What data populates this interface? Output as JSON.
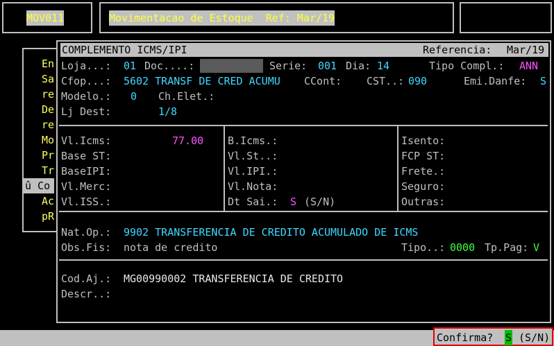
{
  "header": {
    "program_code": "MOV011",
    "title": "Movimentacao de Estoque  Ref: Mar/19"
  },
  "side_menu": {
    "items": [
      "En",
      "Sa",
      "re",
      "De",
      "re",
      "Mo",
      "Pr",
      "Tr",
      "û Co",
      "Ac",
      "pR"
    ],
    "selected_index": 8
  },
  "dialog": {
    "title": "COMPLEMENTO ICMS/IPI",
    "referencia_label": "Referencia:",
    "referencia_value": "Mar/19",
    "row1": {
      "loja_label": "Loja...:",
      "loja_value": "01",
      "doc_label": "Doc....:",
      "doc_value": "",
      "serie_label": "Serie:",
      "serie_value": "001",
      "dia_label": "Dia:",
      "dia_value": "14",
      "tipo_compl_label": "Tipo Compl.:",
      "tipo_compl_value": "ANN"
    },
    "row2": {
      "cfop_label": "Cfop...:",
      "cfop_value": "5602 TRANSF DE CRED ACUMU",
      "ccont_label": "CCont:",
      "cst_label": "CST..:",
      "cst_value": "090",
      "emi_danfe_label": "Emi.Danfe:",
      "emi_danfe_value": "S"
    },
    "row3": {
      "modelo_label": "Modelo.:",
      "modelo_value": "0",
      "ch_elet_label": "Ch.Elet.:"
    },
    "row4": {
      "lj_dest_label": "Lj Dest:",
      "lj_dest_value": "1/8"
    },
    "values_col1": {
      "vl_icms_label": "Vl.Icms:",
      "vl_icms_value": "77.00",
      "base_st_label": "Base ST:",
      "base_ipi_label": "BaseIPI:",
      "vl_merc_label": "Vl.Merc:",
      "vl_iss_label": "Vl.ISS.:"
    },
    "values_col2": {
      "b_icms_label": "B.Icms.:",
      "vl_st_label": "Vl.St..:",
      "vl_ipi_label": "Vl.IPI.:",
      "vl_nota_label": "Vl.Nota:",
      "dt_sai_label": "Dt Sai.:",
      "dt_sai_value": "S",
      "dt_sai_hint": "(S/N)"
    },
    "values_col3": {
      "isento_label": "Isento:",
      "fcp_st_label": "FCP ST:",
      "frete_label": "Frete.:",
      "seguro_label": "Seguro:",
      "outras_label": "Outras:"
    },
    "nat_op_label": "Nat.Op.:",
    "nat_op_value": "9902 TRANSFERENCIA DE CREDITO ACUMULADO DE ICMS",
    "obs_fis_label": "Obs.Fis:",
    "obs_fis_value": "nota de credito",
    "tipo_label": "Tipo..:",
    "tipo_value": "0000",
    "tp_pag_label": "Tp.Pag:",
    "tp_pag_value": "V",
    "cod_aj_label": "Cod.Aj.:",
    "cod_aj_value": "MG00990002 TRANSFERENCIA DE CREDITO",
    "descr_label": "Descr..:"
  },
  "status_bar": {
    "confirm_label": "Confirma?",
    "confirm_value": "S",
    "confirm_hint": "(S/N)"
  }
}
